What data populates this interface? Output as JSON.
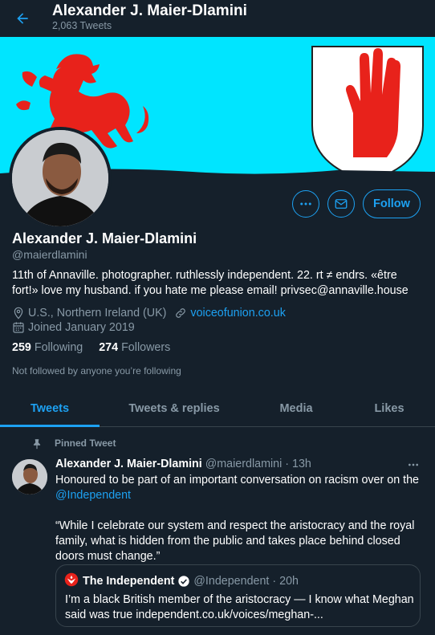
{
  "header": {
    "display_name": "Alexander J. Maier-Dlamini",
    "tweet_count": "2,063 Tweets"
  },
  "actions": {
    "follow_label": "Follow"
  },
  "profile": {
    "name": "Alexander J. Maier-Dlamini",
    "handle": "@maierdlamini",
    "bio": "11th of Annaville. photographer. ruthlessly independent. 22. rt ≠ endrs. «être fort!» love my husband. if you hate me please email! privsec@annaville.house",
    "location": "U.S., Northern Ireland (UK)",
    "website": "voiceofunion.co.uk",
    "joined": "Joined January 2019",
    "following_count": "259",
    "following_label": "Following",
    "followers_count": "274",
    "followers_label": "Followers",
    "not_followed_note": "Not followed by anyone you’re following"
  },
  "tabs": [
    {
      "label": "Tweets",
      "active": true
    },
    {
      "label": "Tweets & replies",
      "active": false
    },
    {
      "label": "Media",
      "active": false
    },
    {
      "label": "Likes",
      "active": false
    }
  ],
  "pinned_tweet": {
    "pinned_label": "Pinned Tweet",
    "author_name": "Alexander J. Maier-Dlamini",
    "author_handle": "@maierdlamini",
    "time": "13h",
    "text_line1": "Honoured to be part of an important conversation on racism over on the",
    "mention": "@Independent",
    "text_quote": "“While I celebrate our system and respect the aristocracy and the royal family, what is hidden from the public and takes place behind closed doors must change.”",
    "quoted": {
      "author_name": "The Independent",
      "author_handle": "@Independent",
      "time": "20h",
      "text": "I’m a black British member of the aristocracy — I know what Meghan said was true independent.co.uk/voices/meghan-..."
    }
  },
  "colors": {
    "background": "#15202b",
    "accent": "#1da1f2",
    "muted": "#8899a6",
    "banner": "#00e5ff",
    "heraldic_red": "#e8221b"
  }
}
